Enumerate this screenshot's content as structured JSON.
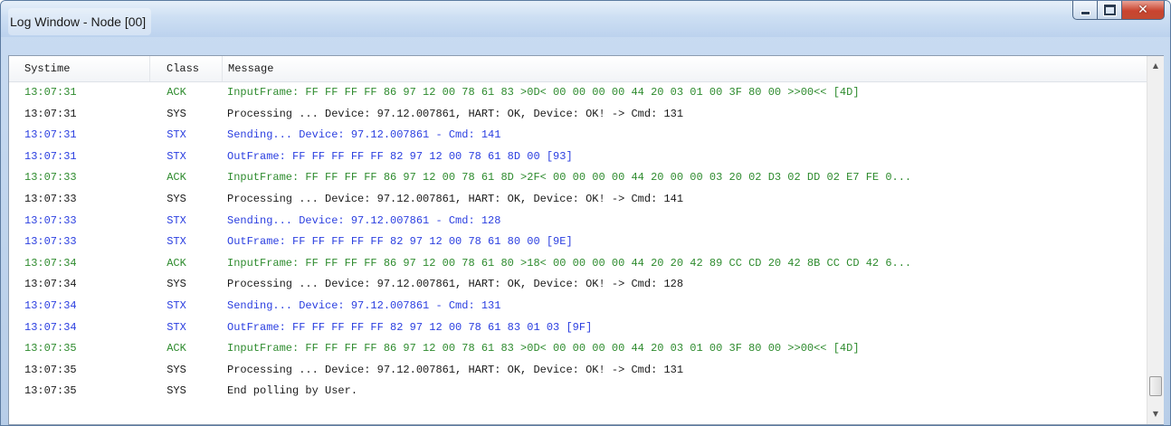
{
  "window": {
    "title": "Log Window - Node [00]",
    "buttons": {
      "minimize": "minimize-icon",
      "maximize": "maximize-icon",
      "close": "close-icon"
    }
  },
  "columns": {
    "systime": "Systime",
    "class": "Class",
    "message": "Message"
  },
  "colors": {
    "ACK": "#2e8b2e",
    "SYS": "#1a1a1a",
    "STX": "#2a3ee0"
  },
  "rows": [
    {
      "time": "13:07:31",
      "cls": "ACK",
      "msg": "InputFrame: FF FF FF FF 86 97 12 00 78 61 83 >0D< 00 00 00 00 44 20 03 01 00 3F 80 00 >>00<< [4D]"
    },
    {
      "time": "13:07:31",
      "cls": "SYS",
      "msg": "Processing ... Device: 97.12.007861, HART: OK, Device: OK! -> Cmd: 131"
    },
    {
      "time": "13:07:31",
      "cls": "STX",
      "msg": "Sending... Device: 97.12.007861 - Cmd: 141"
    },
    {
      "time": "13:07:31",
      "cls": "STX",
      "msg": "OutFrame: FF FF FF FF FF 82 97 12 00 78 61 8D 00 [93]"
    },
    {
      "time": "13:07:33",
      "cls": "ACK",
      "msg": "InputFrame: FF FF FF FF 86 97 12 00 78 61 8D >2F< 00 00 00 00 44 20 00 00 03 20 02 D3 02 DD 02 E7 FE 0..."
    },
    {
      "time": "13:07:33",
      "cls": "SYS",
      "msg": "Processing ... Device: 97.12.007861, HART: OK, Device: OK! -> Cmd: 141"
    },
    {
      "time": "13:07:33",
      "cls": "STX",
      "msg": "Sending... Device: 97.12.007861 - Cmd: 128"
    },
    {
      "time": "13:07:33",
      "cls": "STX",
      "msg": "OutFrame: FF FF FF FF FF 82 97 12 00 78 61 80 00 [9E]"
    },
    {
      "time": "13:07:34",
      "cls": "ACK",
      "msg": "InputFrame: FF FF FF FF 86 97 12 00 78 61 80 >18< 00 00 00 00 44 20 20 42 89 CC CD 20 42 8B CC CD 42 6..."
    },
    {
      "time": "13:07:34",
      "cls": "SYS",
      "msg": "Processing ... Device: 97.12.007861, HART: OK, Device: OK! -> Cmd: 128"
    },
    {
      "time": "13:07:34",
      "cls": "STX",
      "msg": "Sending... Device: 97.12.007861 - Cmd: 131"
    },
    {
      "time": "13:07:34",
      "cls": "STX",
      "msg": "OutFrame: FF FF FF FF FF 82 97 12 00 78 61 83 01 03 [9F]"
    },
    {
      "time": "13:07:35",
      "cls": "ACK",
      "msg": "InputFrame: FF FF FF FF 86 97 12 00 78 61 83 >0D< 00 00 00 00 44 20 03 01 00 3F 80 00 >>00<< [4D]"
    },
    {
      "time": "13:07:35",
      "cls": "SYS",
      "msg": "Processing ... Device: 97.12.007861, HART: OK, Device: OK! -> Cmd: 131"
    },
    {
      "time": "13:07:35",
      "cls": "SYS",
      "msg": "End polling by User."
    }
  ],
  "scrollbar": {
    "up_icon": "scroll-up-arrow-icon",
    "down_icon": "scroll-down-arrow-icon"
  }
}
